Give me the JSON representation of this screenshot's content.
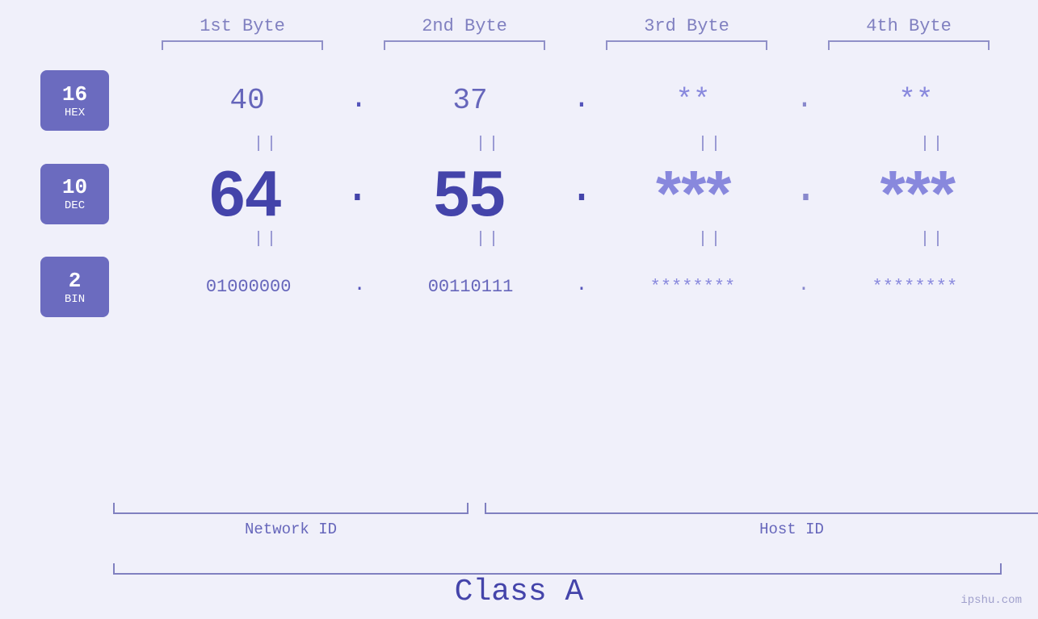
{
  "byteHeaders": {
    "b1": "1st Byte",
    "b2": "2nd Byte",
    "b3": "3rd Byte",
    "b4": "4th Byte"
  },
  "badges": {
    "hex": {
      "num": "16",
      "base": "HEX"
    },
    "dec": {
      "num": "10",
      "base": "DEC"
    },
    "bin": {
      "num": "2",
      "base": "BIN"
    }
  },
  "rows": {
    "hex": {
      "b1": "40",
      "b2": "37",
      "b3": "**",
      "b4": "**"
    },
    "dec": {
      "b1": "64",
      "b2": "55",
      "b3": "***",
      "b4": "***"
    },
    "bin": {
      "b1": "01000000",
      "b2": "00110111",
      "b3": "********",
      "b4": "********"
    }
  },
  "labels": {
    "networkId": "Network ID",
    "hostId": "Host ID",
    "classLabel": "Class A"
  },
  "watermark": "ipshu.com",
  "equalsSigns": "||"
}
